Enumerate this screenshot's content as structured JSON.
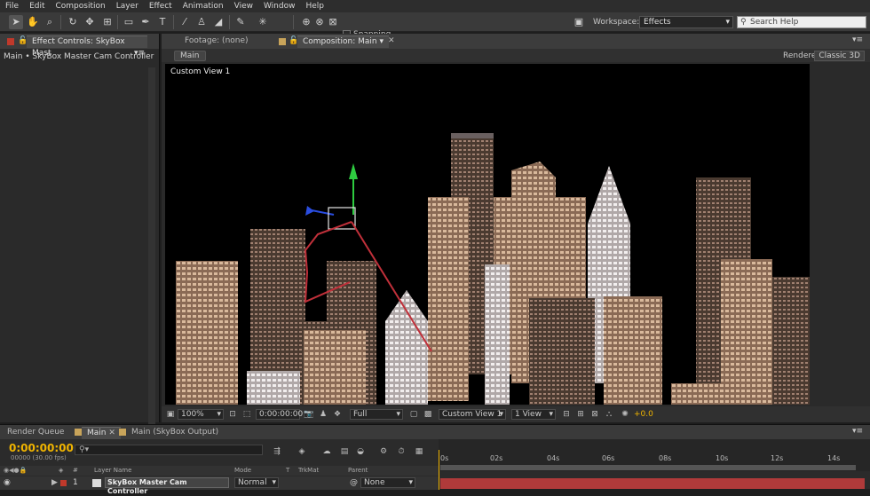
{
  "menu": [
    "File",
    "Edit",
    "Composition",
    "Layer",
    "Effect",
    "Animation",
    "View",
    "Window",
    "Help"
  ],
  "toolbar": {
    "snapping_label": "Snapping",
    "workspace_label": "Workspace:",
    "workspace_value": "Effects",
    "search_placeholder": "Search Help"
  },
  "left_panel": {
    "tab_label": "Effect Controls: SkyBox Mast",
    "subtitle": "Main • SkyBox Master Cam Controller"
  },
  "comp_panel": {
    "tabs": [
      "Footage: (none)",
      "Composition: Main"
    ],
    "main_button": "Main",
    "renderer_label": "Renderer:",
    "renderer_value": "Classic 3D",
    "view_label": "Custom View 1",
    "footer": {
      "zoom": "100%",
      "timecode": "0:00:00:00",
      "resolution": "Full",
      "view": "Custom View 1",
      "views": "1 View",
      "exposure": "+0.0"
    }
  },
  "timeline": {
    "tabs": [
      "Render Queue",
      "Main",
      "Main (SkyBox Output)"
    ],
    "timecode": "0:00:00:00",
    "fps": "00000 (30.00 fps)",
    "ticks": [
      "0s",
      "02s",
      "04s",
      "06s",
      "08s",
      "10s",
      "12s",
      "14s"
    ],
    "headers": {
      "layer_name": "Layer Name",
      "mode": "Mode",
      "t": "T",
      "trkmat": "TrkMat",
      "parent": "Parent"
    },
    "layer": {
      "number": "1",
      "name": "SkyBox Master Cam Controller",
      "mode": "Normal",
      "parent": "None"
    }
  },
  "colors": {
    "timecode": "#f0b400",
    "track": "#b03a3a"
  }
}
